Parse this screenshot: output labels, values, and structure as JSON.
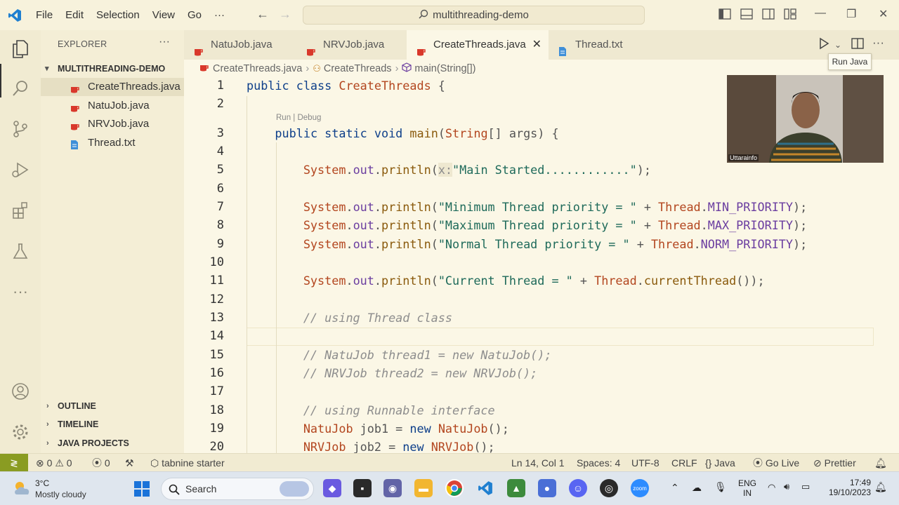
{
  "window": {
    "menu": [
      "File",
      "Edit",
      "Selection",
      "View",
      "Go",
      "···"
    ],
    "command_center": "multithreading-demo"
  },
  "explorer": {
    "header": "EXPLORER",
    "more": "···",
    "folder": "MULTITHREADING-DEMO",
    "files": [
      {
        "name": "CreateThreads.java",
        "type": "java",
        "selected": true
      },
      {
        "name": "NatuJob.java",
        "type": "java",
        "selected": false
      },
      {
        "name": "NRVJob.java",
        "type": "java",
        "selected": false
      },
      {
        "name": "Thread.txt",
        "type": "text",
        "selected": false
      }
    ],
    "sections": [
      "OUTLINE",
      "TIMELINE",
      "JAVA PROJECTS"
    ]
  },
  "tabs": [
    {
      "label": "NatuJob.java",
      "type": "java",
      "active": false
    },
    {
      "label": "NRVJob.java",
      "type": "java",
      "active": false
    },
    {
      "label": "CreateThreads.java",
      "type": "java",
      "active": true,
      "close": "✕"
    },
    {
      "label": "Thread.txt",
      "type": "text",
      "active": false
    }
  ],
  "tooltip": "Run Java",
  "breadcrumb": [
    "CreateThreads.java",
    "CreateThreads",
    "main(String[])"
  ],
  "codelens": "Run | Debug",
  "editor": {
    "line_numbers": [
      "1",
      "2",
      "3",
      "4",
      "5",
      "6",
      "7",
      "8",
      "9",
      "10",
      "11",
      "12",
      "13",
      "14",
      "15",
      "16",
      "17",
      "18",
      "19",
      "20"
    ]
  },
  "webcam_label": "Uttarainfo",
  "statusbar": {
    "errors": "0",
    "warnings": "0",
    "ports": "0",
    "tabnine": "tabnine starter",
    "position": "Ln 14, Col 1",
    "spaces": "Spaces: 4",
    "encoding": "UTF-8",
    "eol": "CRLF",
    "language": "Java",
    "golive": "Go Live",
    "prettier": "Prettier"
  },
  "taskbar": {
    "temp": "3°C",
    "weather": "Mostly cloudy",
    "search": "Search",
    "lang_top": "ENG",
    "lang_bottom": "IN",
    "time": "17:49",
    "date": "19/10/2023"
  },
  "colors": {
    "editor_bg": "#fbf7e6",
    "keyword": "#0e3f8a",
    "class": "#b3461f",
    "string": "#1e6a5a",
    "comment": "#8d8d8d",
    "java_icon": "#d9382b",
    "text_icon": "#3f8fd8",
    "remote": "#8a9c22"
  }
}
